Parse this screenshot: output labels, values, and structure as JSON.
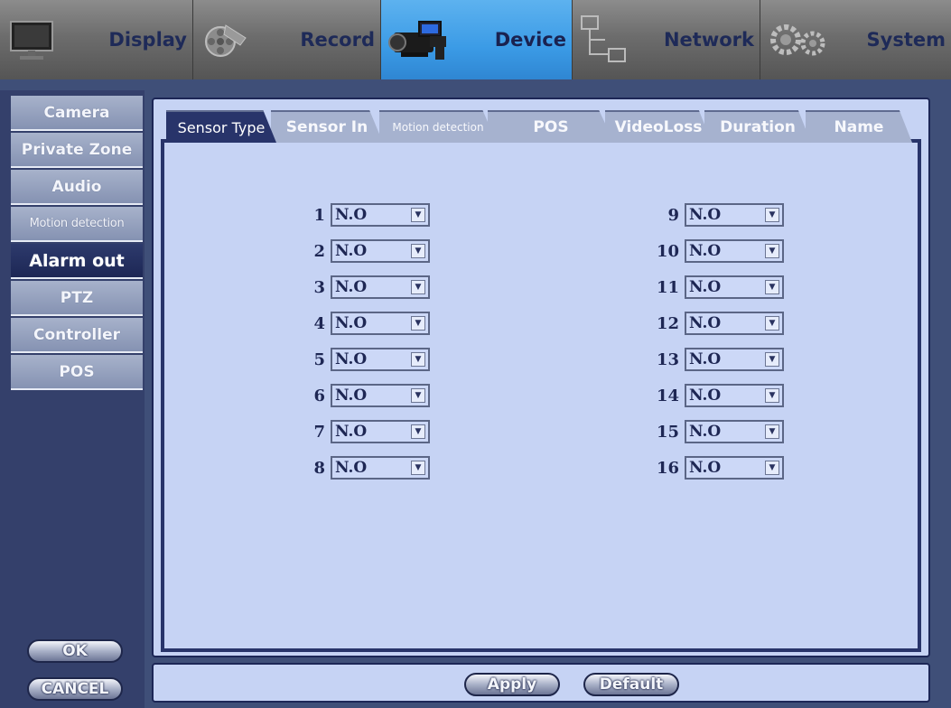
{
  "topnav": {
    "items": [
      {
        "label": "Display",
        "icon": "monitor-icon"
      },
      {
        "label": "Record",
        "icon": "film-reel-icon"
      },
      {
        "label": "Device",
        "icon": "camcorder-icon",
        "active": true
      },
      {
        "label": "Network",
        "icon": "network-icon"
      },
      {
        "label": "System",
        "icon": "gears-icon"
      }
    ]
  },
  "sidebar": {
    "items": [
      {
        "label": "Camera"
      },
      {
        "label": "Private Zone"
      },
      {
        "label": "Audio"
      },
      {
        "label": "Motion detection"
      },
      {
        "label": "Alarm out",
        "active": true
      },
      {
        "label": "PTZ"
      },
      {
        "label": "Controller"
      },
      {
        "label": "POS"
      }
    ],
    "ok_label": "OK",
    "cancel_label": "CANCEL"
  },
  "tabs": [
    {
      "label": "Sensor Type",
      "active": true
    },
    {
      "label": "Sensor In"
    },
    {
      "label": "Motion detection"
    },
    {
      "label": "POS"
    },
    {
      "label": "VideoLoss"
    },
    {
      "label": "Duration"
    },
    {
      "label": "Name"
    }
  ],
  "sensors": {
    "left": [
      {
        "num": "1",
        "value": "N.O"
      },
      {
        "num": "2",
        "value": "N.O"
      },
      {
        "num": "3",
        "value": "N.O"
      },
      {
        "num": "4",
        "value": "N.O"
      },
      {
        "num": "5",
        "value": "N.O"
      },
      {
        "num": "6",
        "value": "N.O"
      },
      {
        "num": "7",
        "value": "N.O"
      },
      {
        "num": "8",
        "value": "N.O"
      }
    ],
    "right": [
      {
        "num": "9",
        "value": "N.O"
      },
      {
        "num": "10",
        "value": "N.O"
      },
      {
        "num": "11",
        "value": "N.O"
      },
      {
        "num": "12",
        "value": "N.O"
      },
      {
        "num": "13",
        "value": "N.O"
      },
      {
        "num": "14",
        "value": "N.O"
      },
      {
        "num": "15",
        "value": "N.O"
      },
      {
        "num": "16",
        "value": "N.O"
      }
    ]
  },
  "actions": {
    "apply_label": "Apply",
    "default_label": "Default"
  },
  "colors": {
    "active_nav": "#3b9be6",
    "panel_bg": "#c6d3f4",
    "dark_blue": "#28346a"
  }
}
